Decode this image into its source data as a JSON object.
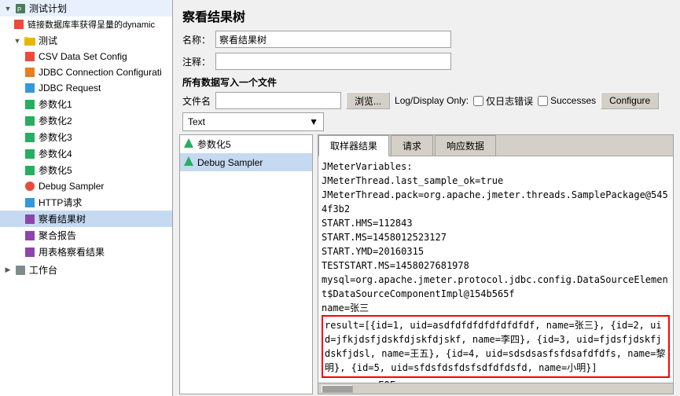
{
  "leftPanel": {
    "items": [
      {
        "id": "test-plan",
        "label": "测试计划",
        "level": 0,
        "indent": 0,
        "icon": "plan",
        "expanded": true,
        "arrow": "▼"
      },
      {
        "id": "link-sampler",
        "label": "链接数据库率获得呈量的dynamic",
        "level": 1,
        "indent": 1,
        "icon": "sampler"
      },
      {
        "id": "test",
        "label": "测试",
        "level": 1,
        "indent": 1,
        "icon": "folder",
        "expanded": true,
        "arrow": "▼"
      },
      {
        "id": "csv",
        "label": "CSV Data Set Config",
        "level": 2,
        "indent": 2,
        "icon": "csv"
      },
      {
        "id": "jdbc",
        "label": "JDBC Connection Configurati",
        "level": 2,
        "indent": 2,
        "icon": "jdbc"
      },
      {
        "id": "jdbc-req",
        "label": "JDBC Request",
        "level": 2,
        "indent": 2,
        "icon": "request"
      },
      {
        "id": "param1",
        "label": "参数化1",
        "level": 2,
        "indent": 2,
        "icon": "param"
      },
      {
        "id": "param2",
        "label": "参数化2",
        "level": 2,
        "indent": 2,
        "icon": "param"
      },
      {
        "id": "param3",
        "label": "参数化3",
        "level": 2,
        "indent": 2,
        "icon": "param"
      },
      {
        "id": "param4",
        "label": "参数化4",
        "level": 2,
        "indent": 2,
        "icon": "param"
      },
      {
        "id": "param5",
        "label": "参数化5",
        "level": 2,
        "indent": 2,
        "icon": "param"
      },
      {
        "id": "debug",
        "label": "Debug Sampler",
        "level": 2,
        "indent": 2,
        "icon": "debug"
      },
      {
        "id": "http",
        "label": "HTTP请求",
        "level": 2,
        "indent": 2,
        "icon": "request"
      },
      {
        "id": "result-tree",
        "label": "察看结果树",
        "level": 2,
        "indent": 2,
        "icon": "listener",
        "selected": true
      },
      {
        "id": "aggregate",
        "label": "聚合报告",
        "level": 2,
        "indent": 2,
        "icon": "listener"
      },
      {
        "id": "table-result",
        "label": "用表格察看结果",
        "level": 2,
        "indent": 2,
        "icon": "listener"
      },
      {
        "id": "workbench",
        "label": "工作台",
        "level": 0,
        "indent": 0,
        "icon": "workbench",
        "arrow": "▶"
      }
    ]
  },
  "rightPanel": {
    "title": "察看结果树",
    "nameLabel": "名称：",
    "nameValue": "察看结果树",
    "commentLabel": "注释：",
    "commentValue": "",
    "sectionLabel": "所有数据写入一个文件",
    "fileLabel": "文件名",
    "fileValue": "",
    "browseBtn": "浏览...",
    "logDisplayLabel": "Log/Display Only:",
    "errorsLabel": "仅日志错误",
    "successesLabel": "Successes",
    "configureBtn": "Configure",
    "textDropdown": "Text",
    "textDropdownArrow": "▼",
    "tabs": [
      {
        "id": "sampler",
        "label": "取样器结果",
        "active": true
      },
      {
        "id": "request",
        "label": "请求",
        "active": false
      },
      {
        "id": "response",
        "label": "响应数据",
        "active": false
      }
    ],
    "contentTree": [
      {
        "label": "参数化5",
        "icon": "green"
      },
      {
        "label": "Debug Sampler",
        "icon": "green"
      }
    ],
    "resultText": "JMeterVariables:\nJMeterThread.last_sample_ok=true\nJMeterThread.pack=org.apache.jmeter.threads.SamplePackage@5454f3b2\nSTART.HMS=112843\nSTART.MS=1458012523127\nSTART.YMD=20160315\nTESTSTART.MS=1458027681978\nmysql=org.apache.jmeter.protocol.jdbc.config.DataSourceElement$DataSourceComponentImpl@154b565f\nname=张三",
    "resultHighlight": "result=[{id=1, uid=asdfdfdfdfdfdfdfdf, name=张三}, {id=2, uid=jfkjdsfjdskfdjskfdjskf, name=李四}, {id=3, uid=fjdsfjdskfjdskfjdsl, name=王五}, {id=4, uid=sdsdsasfsfdsafdfdfs, name=黎明}, {id=5, uid=sfdsfdsfdsfsdfdfdsfd, name=小明}]",
    "resultBottom": "username=<EOF>"
  }
}
